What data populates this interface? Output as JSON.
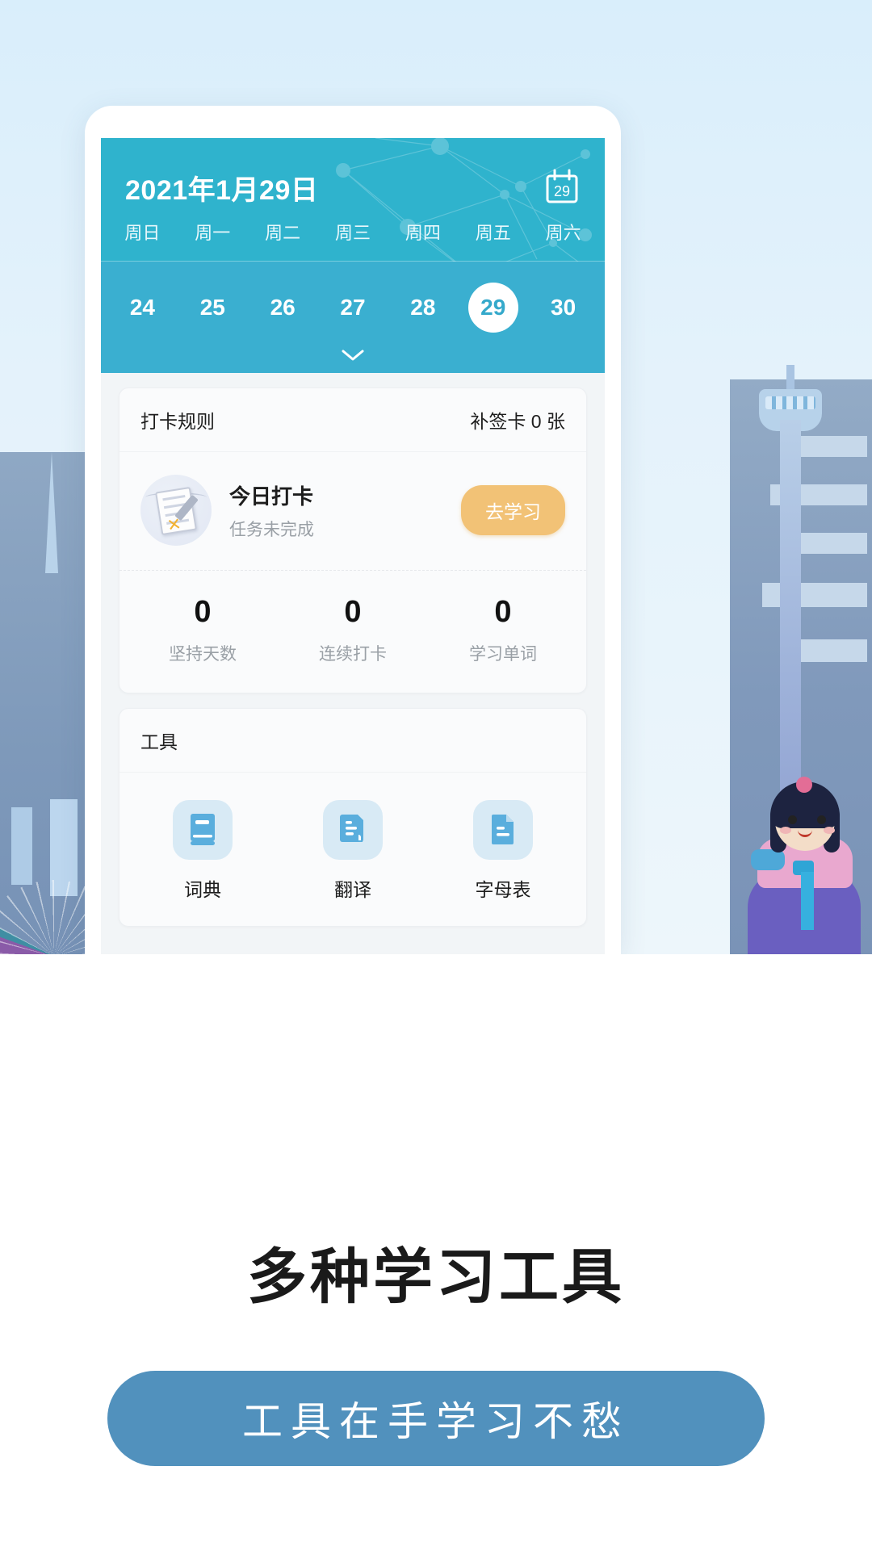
{
  "calendar": {
    "date_title": "2021年1月29日",
    "icon_day": "29",
    "weekdays": [
      "周日",
      "周一",
      "周二",
      "周三",
      "周四",
      "周五",
      "周六"
    ],
    "days": [
      "24",
      "25",
      "26",
      "27",
      "28",
      "29",
      "30"
    ],
    "selected_day": "29",
    "expand_icon": "chevron-down-icon",
    "header_color": "#2fb3cd",
    "body_color": "#3aafd0"
  },
  "checkin_card": {
    "rules_label": "打卡规则",
    "makeup_cards_label": "补签卡 0 张",
    "today_title": "今日打卡",
    "today_status": "任务未完成",
    "action_button": "去学习",
    "action_button_color": "#f2c276",
    "stats": [
      {
        "value": "0",
        "label": "坚持天数"
      },
      {
        "value": "0",
        "label": "连续打卡"
      },
      {
        "value": "0",
        "label": "学习单词"
      }
    ]
  },
  "tools_card": {
    "section_title": "工具",
    "items": [
      {
        "label": "词典",
        "icon": "book-icon"
      },
      {
        "label": "翻译",
        "icon": "translate-document-icon"
      },
      {
        "label": "字母表",
        "icon": "file-text-icon"
      }
    ],
    "icon_color": "#5aaedd",
    "icon_bg_color": "#d8eaf5"
  },
  "promo": {
    "title": "多种学习工具",
    "button_label": "工具在手学习不愁",
    "button_color": "#5191bd"
  }
}
